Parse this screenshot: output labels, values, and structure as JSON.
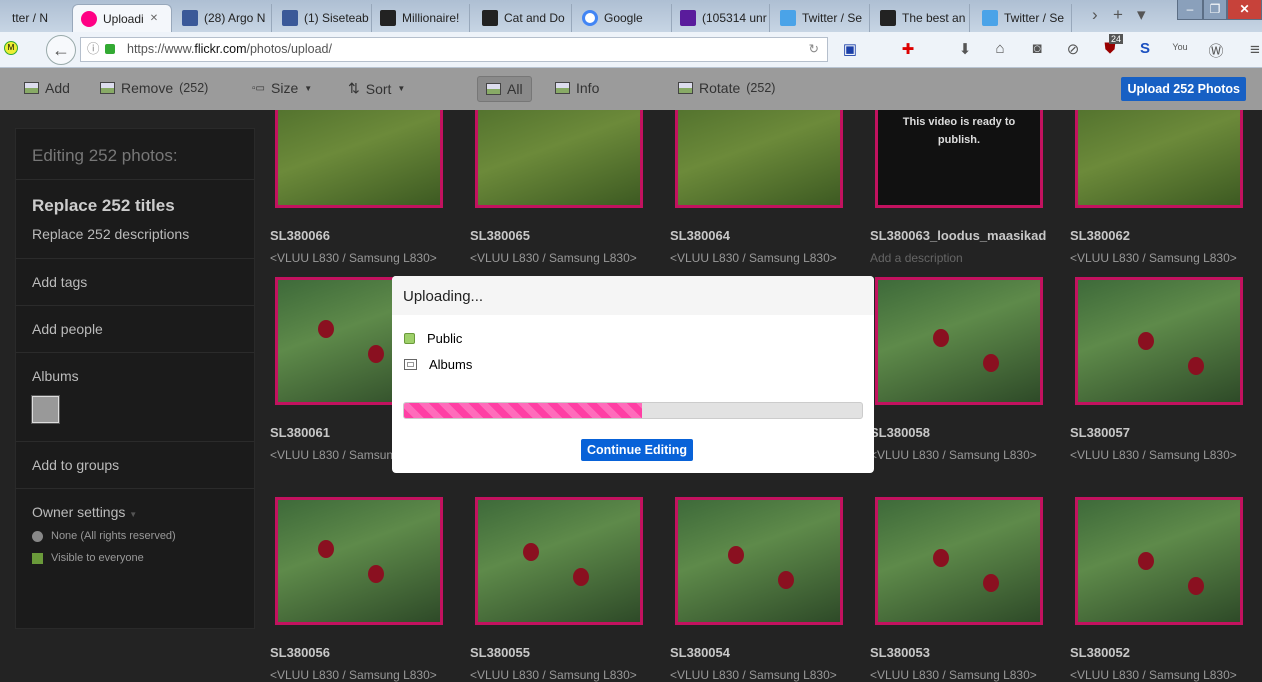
{
  "browser": {
    "tabs": [
      {
        "label": "tter / N",
        "icon": "twitter"
      },
      {
        "label": "Uploadi",
        "icon": "flickr",
        "active": true
      },
      {
        "label": "(28) Argo N",
        "icon": "facebook"
      },
      {
        "label": "(1) Siseteab",
        "icon": "facebook"
      },
      {
        "label": "Millionaire!",
        "icon": "heart-logo"
      },
      {
        "label": "Cat and Do",
        "icon": "heart-logo"
      },
      {
        "label": "Google",
        "icon": "google"
      },
      {
        "label": "(105314 unr",
        "icon": "mail"
      },
      {
        "label": "Twitter / Se",
        "icon": "twitter"
      },
      {
        "label": "The best an",
        "icon": "heart-logo"
      },
      {
        "label": "Twitter / Se",
        "icon": "twitter"
      }
    ],
    "url_prefix": "https://www.",
    "url_domain": "flickr.com",
    "url_path": "/photos/upload/",
    "badge_count": "24"
  },
  "toolbar": {
    "add": "Add",
    "remove": "Remove",
    "remove_count": "(252)",
    "size": "Size",
    "sort": "Sort",
    "all": "All",
    "info": "Info",
    "rotate": "Rotate",
    "rotate_count": "(252)",
    "upload": "Upload 252 Photos"
  },
  "sidebar": {
    "heading": "Editing 252 photos:",
    "titles": "Replace 252 titles",
    "descriptions": "Replace 252 descriptions",
    "tags": "Add tags",
    "people": "Add people",
    "albums": "Albums",
    "groups": "Add to groups",
    "owner": "Owner settings",
    "license": "None (All rights reserved)",
    "visibility": "Visible to everyone"
  },
  "photos": [
    {
      "title": "SL380066",
      "desc": "<VLUU L830 / Samsung L830>"
    },
    {
      "title": "SL380065",
      "desc": "<VLUU L830 / Samsung L830>"
    },
    {
      "title": "SL380064",
      "desc": "<VLUU L830 / Samsung L830>"
    },
    {
      "title": "SL380063_loodus_maasikad",
      "desc": "Add a description",
      "video_note": "This video is ready to publish."
    },
    {
      "title": "SL380062",
      "desc": "<VLUU L830 / Samsung L830>"
    },
    {
      "title": "SL380061",
      "desc": "<VLUU L830 / Samsung L830>"
    },
    {
      "title": "",
      "desc": ""
    },
    {
      "title": "",
      "desc": ""
    },
    {
      "title": "SL380058",
      "desc": "<VLUU L830 / Samsung L830>"
    },
    {
      "title": "SL380057",
      "desc": "<VLUU L830 / Samsung L830>"
    },
    {
      "title": "SL380056",
      "desc": "<VLUU L830 / Samsung L830>"
    },
    {
      "title": "SL380055",
      "desc": "<VLUU L830 / Samsung L830>"
    },
    {
      "title": "SL380054",
      "desc": "<VLUU L830 / Samsung L830>"
    },
    {
      "title": "SL380053",
      "desc": "<VLUU L830 / Samsung L830>"
    },
    {
      "title": "SL380052",
      "desc": "<VLUU L830 / Samsung L830>"
    }
  ],
  "dialog": {
    "title": "Uploading...",
    "public": "Public",
    "albums": "Albums",
    "progress_percent": 52,
    "continue": "Continue Editing",
    "progress_color": "#ff3fa4"
  }
}
